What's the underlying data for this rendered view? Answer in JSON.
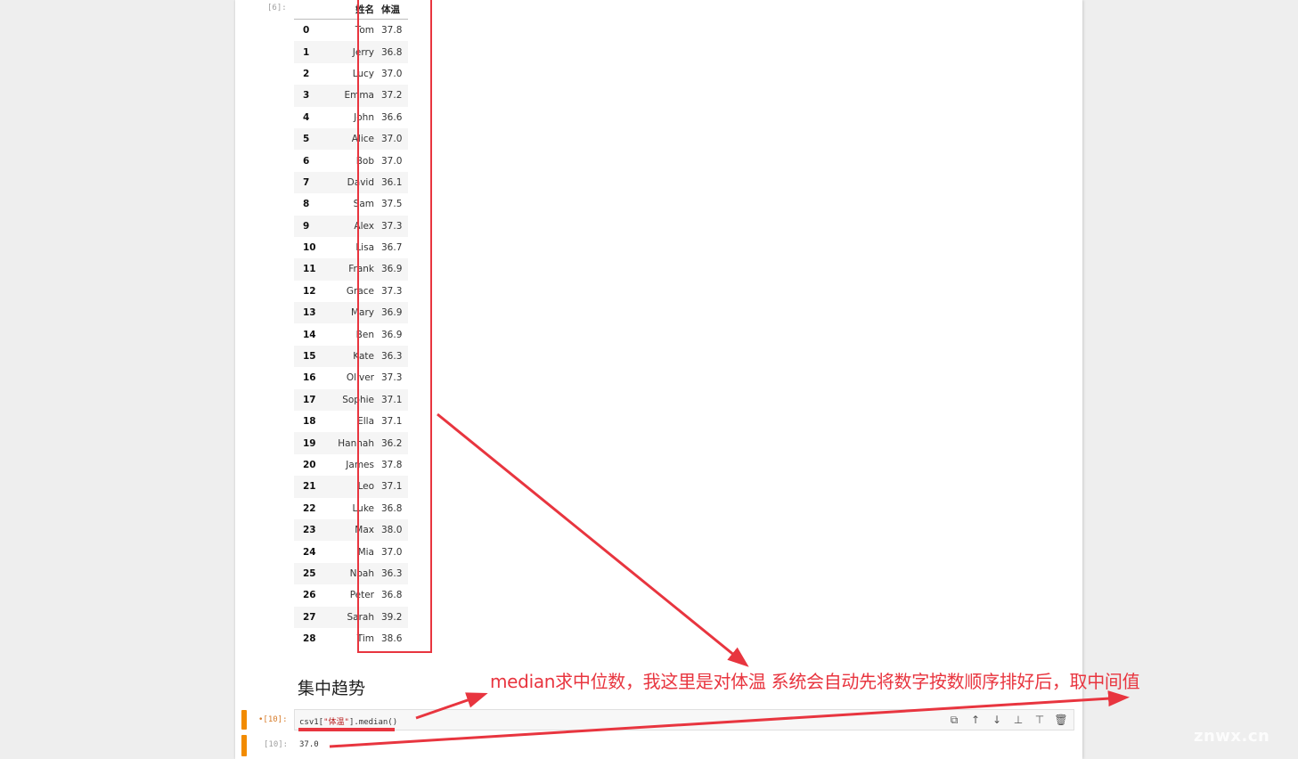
{
  "output_cell": {
    "prompt": "[6]:",
    "columns": [
      "姓名",
      "体温"
    ],
    "rows": [
      {
        "index": "0",
        "name": "Tom",
        "temp": "37.8"
      },
      {
        "index": "1",
        "name": "Jerry",
        "temp": "36.8"
      },
      {
        "index": "2",
        "name": "Lucy",
        "temp": "37.0"
      },
      {
        "index": "3",
        "name": "Emma",
        "temp": "37.2"
      },
      {
        "index": "4",
        "name": "John",
        "temp": "36.6"
      },
      {
        "index": "5",
        "name": "Alice",
        "temp": "37.0"
      },
      {
        "index": "6",
        "name": "Bob",
        "temp": "37.0"
      },
      {
        "index": "7",
        "name": "David",
        "temp": "36.1"
      },
      {
        "index": "8",
        "name": "Sam",
        "temp": "37.5"
      },
      {
        "index": "9",
        "name": "Alex",
        "temp": "37.3"
      },
      {
        "index": "10",
        "name": "Lisa",
        "temp": "36.7"
      },
      {
        "index": "11",
        "name": "Frank",
        "temp": "36.9"
      },
      {
        "index": "12",
        "name": "Grace",
        "temp": "37.3"
      },
      {
        "index": "13",
        "name": "Mary",
        "temp": "36.9"
      },
      {
        "index": "14",
        "name": "Ben",
        "temp": "36.9"
      },
      {
        "index": "15",
        "name": "Kate",
        "temp": "36.3"
      },
      {
        "index": "16",
        "name": "Oliver",
        "temp": "37.3"
      },
      {
        "index": "17",
        "name": "Sophie",
        "temp": "37.1"
      },
      {
        "index": "18",
        "name": "Ella",
        "temp": "37.1"
      },
      {
        "index": "19",
        "name": "Hannah",
        "temp": "36.2"
      },
      {
        "index": "20",
        "name": "James",
        "temp": "37.8"
      },
      {
        "index": "21",
        "name": "Leo",
        "temp": "37.1"
      },
      {
        "index": "22",
        "name": "Luke",
        "temp": "36.8"
      },
      {
        "index": "23",
        "name": "Max",
        "temp": "38.0"
      },
      {
        "index": "24",
        "name": "Mia",
        "temp": "37.0"
      },
      {
        "index": "25",
        "name": "Noah",
        "temp": "36.3"
      },
      {
        "index": "26",
        "name": "Peter",
        "temp": "36.8"
      },
      {
        "index": "27",
        "name": "Sarah",
        "temp": "39.2"
      },
      {
        "index": "28",
        "name": "Tim",
        "temp": "38.6"
      }
    ]
  },
  "markdown": {
    "heading": "集中趋势"
  },
  "code_cell": {
    "prompt": "•[10]:",
    "code_var": "csv1[",
    "code_str": "\"体温\"",
    "code_rest": "].median()",
    "toolbar": [
      {
        "name": "duplicate-icon",
        "glyph": "⧉"
      },
      {
        "name": "move-up-icon",
        "glyph": "↑"
      },
      {
        "name": "move-down-icon",
        "glyph": "↓"
      },
      {
        "name": "insert-above-icon",
        "glyph": "⊥"
      },
      {
        "name": "insert-below-icon",
        "glyph": "⊤"
      },
      {
        "name": "delete-icon",
        "glyph": "🗑"
      }
    ]
  },
  "result_cell": {
    "prompt": "[10]:",
    "value": "37.0"
  },
  "annotation": {
    "text": "median求中位数，我这里是对体温  系统会自动先将数字按数顺序排好后，取中间值",
    "color": "#e8353f"
  },
  "watermark": "znwx.cn",
  "colors": {
    "accent_orange": "#f28b00",
    "annotation_red": "#e8353f"
  }
}
